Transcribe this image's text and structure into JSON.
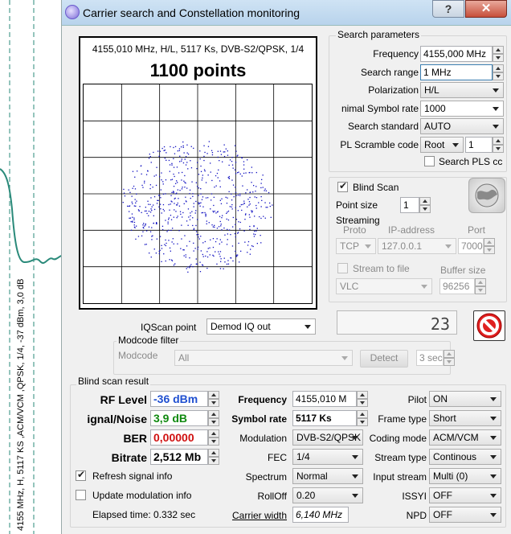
{
  "background_plot": {
    "rotated_text": "4155 MHz, H, 5117 KS ,ACM/VCM ,QPSK, 1/4, -37 dBm, 3,0 dB"
  },
  "window": {
    "title": "Carrier search and Constellation monitoring",
    "help_label": "?",
    "close_label": "✕"
  },
  "constellation": {
    "subtitle": "4155,010 MHz, H/L, 5117 Ks, DVB-S2/QPSK, 1/4",
    "points_label": "1100 points",
    "point_color": "#1010c0"
  },
  "search_parameters": {
    "group_label": "Search parameters",
    "frequency_label": "Frequency",
    "frequency_value": "4155,000 MHz",
    "range_label": "Search range",
    "range_value": "1 MHz",
    "polarization_label": "Polarization",
    "polarization_value": "H/L",
    "symbol_rate_label": "nimal Symbol rate",
    "symbol_rate_value": "1000",
    "standard_label": "Search standard",
    "standard_value": "AUTO",
    "pl_scramble_label": "PL Scramble code",
    "pl_scramble_type": "Root",
    "pl_scramble_value": "1",
    "search_pls_label": "Search PLS cc"
  },
  "blind_scan": {
    "label": "Blind Scan",
    "point_size_label": "Point size",
    "point_size_value": "1"
  },
  "streaming": {
    "group_label": "Streaming",
    "proto_label": "Proto",
    "ip_label": "IP-address",
    "port_label": "Port",
    "proto_value": "TCP",
    "ip_value": "127.0.0.1",
    "port_value": "7000",
    "stream_to_file_label": "Stream to file",
    "buffer_label": "Buffer size",
    "player_value": "VLC",
    "buffer_value": "96256"
  },
  "iqscan": {
    "label": "IQScan point",
    "value": "Demod IQ out",
    "counter": "23"
  },
  "modcode": {
    "group_label": "Modcode filter",
    "modcode_label": "Modcode",
    "modcode_value": "All",
    "detect_label": "Detect",
    "time_value": "3 sec"
  },
  "result": {
    "group_label": "Blind scan result",
    "rf_level_label": "RF Level",
    "rf_level_value": "-36 dBm",
    "snr_label": "ignal/Noise",
    "snr_value": "3,9 dB",
    "ber_label": "BER",
    "ber_value": "0,00000",
    "bitrate_label": "Bitrate",
    "bitrate_value": "2,512 Mb",
    "frequency_label": "Frequency",
    "frequency_value": "4155,010 M",
    "symbol_rate_label": "Symbol rate",
    "symbol_rate_value": "5117 Ks",
    "modulation_label": "Modulation",
    "modulation_value": "DVB-S2/QPSK",
    "fec_label": "FEC",
    "fec_value": "1/4",
    "spectrum_label": "Spectrum",
    "spectrum_value": "Normal",
    "rolloff_label": "RollOff",
    "rolloff_value": "0.20",
    "carrier_width_label": "Carrier width",
    "carrier_width_value": "6,140 MHz",
    "pilot_label": "Pilot",
    "pilot_value": "ON",
    "frame_type_label": "Frame type",
    "frame_type_value": "Short",
    "coding_mode_label": "Coding mode",
    "coding_mode_value": "ACM/VCM",
    "stream_type_label": "Stream type",
    "stream_type_value": "Continous",
    "input_stream_label": "Input stream",
    "input_stream_value": "Multi (0)",
    "issyi_label": "ISSYI",
    "issyi_value": "OFF",
    "npd_label": "NPD",
    "npd_value": "OFF",
    "refresh_label": "Refresh signal info",
    "update_label": "Update modulation info",
    "elapsed_label": "Elapsed time: 0.332 sec",
    "colors": {
      "rf": "#1f4fd0",
      "snr": "#108a10",
      "ber": "#d01010"
    }
  }
}
